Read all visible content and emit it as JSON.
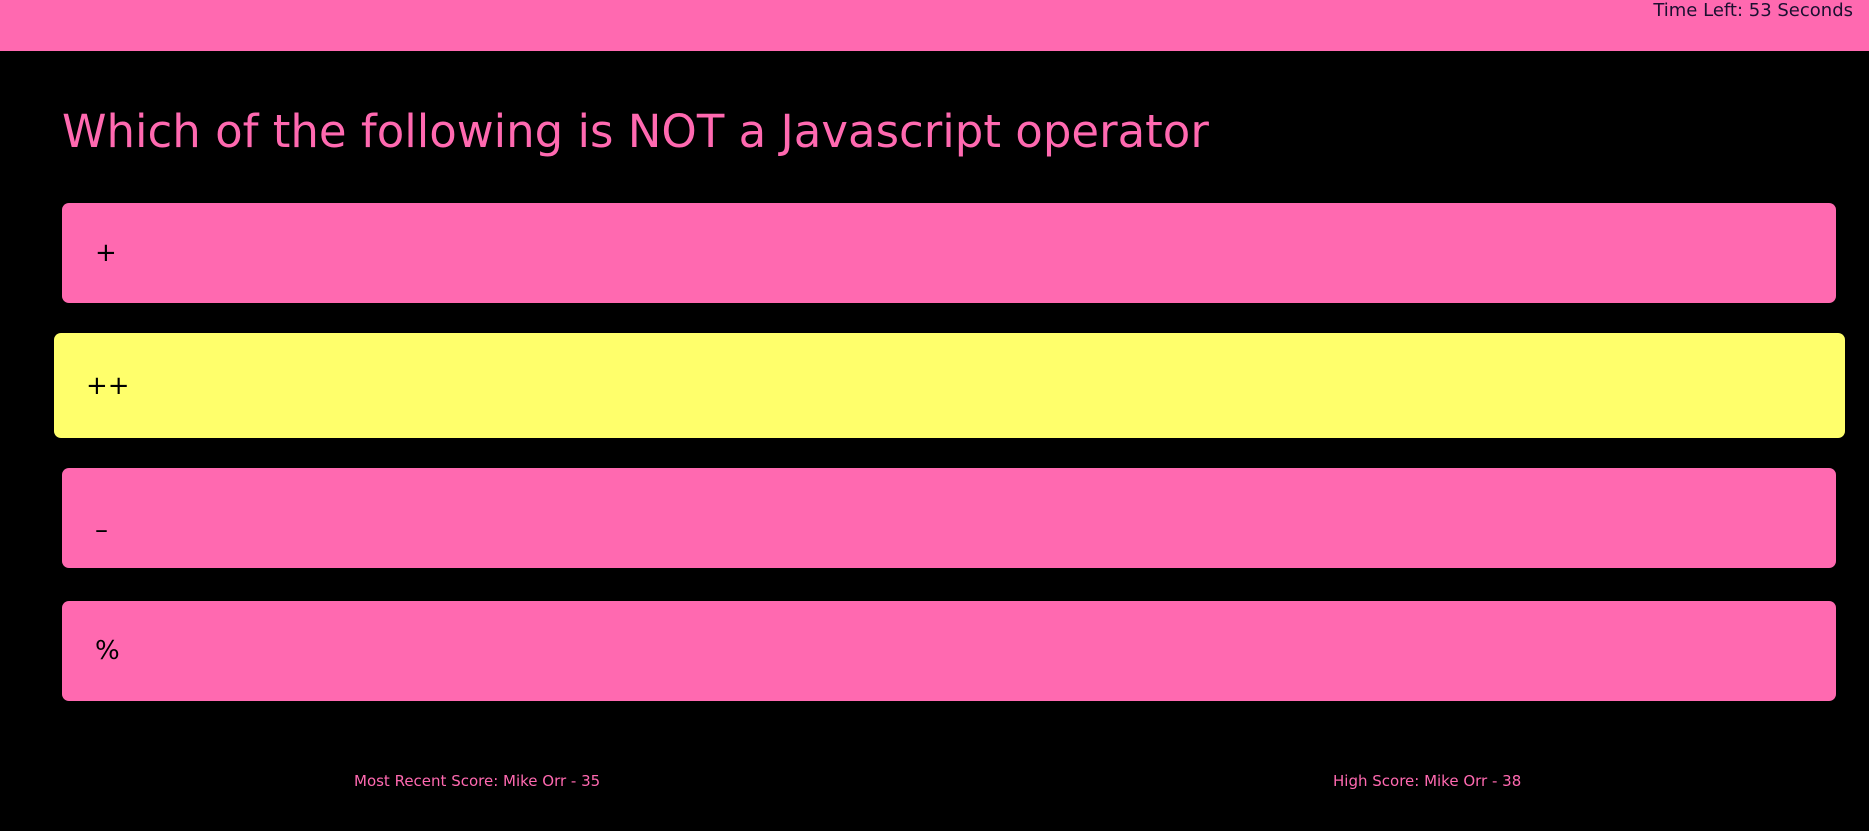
{
  "header": {
    "timer_text": "Time Left: 53 Seconds"
  },
  "question": {
    "title": "Which of the following is NOT a Javascript operator",
    "options": [
      {
        "label": "+"
      },
      {
        "label": "++",
        "state": "hovered"
      },
      {
        "label": "–"
      },
      {
        "label": "%"
      }
    ]
  },
  "footer": {
    "recent_score": "Most Recent Score: Mike Orr - 35",
    "high_score": "High Score: Mike Orr - 38"
  },
  "colors": {
    "accent": "#ff69b0",
    "highlight": "#ffff6b",
    "background": "#000000"
  }
}
